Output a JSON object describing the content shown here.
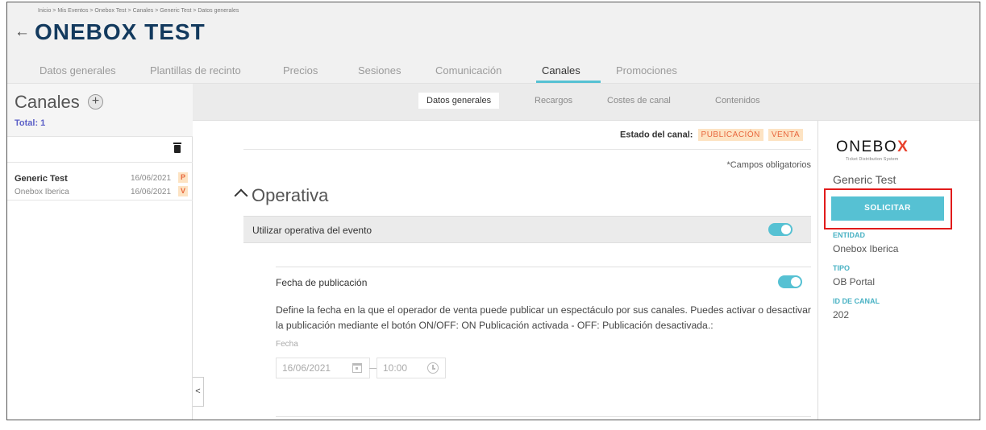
{
  "header": {
    "breadcrumb": "Inicio > Mis Eventos > Onebox Test > Canales > Generic Test > Datos generales",
    "back_icon": "←",
    "title": "ONEBOX TEST",
    "tabs": [
      "Datos generales",
      "Plantillas de recinto",
      "Precios",
      "Sesiones",
      "Comunicación",
      "Canales",
      "Promociones"
    ],
    "active_tab": "Canales"
  },
  "sidebar": {
    "title": "Canales",
    "add_icon": "+",
    "total": "Total: 1",
    "items": [
      {
        "name": "Generic Test",
        "entity": "Onebox Iberica",
        "date1": "16/06/2021",
        "badge1": "P",
        "date2": "16/06/2021",
        "badge2": "V"
      }
    ]
  },
  "subnav": {
    "tabs": [
      "Datos generales",
      "Recargos",
      "Costes de canal",
      "Contenidos"
    ],
    "active": "Datos generales"
  },
  "main": {
    "collapse_icon": "<",
    "estado_label": "Estado del canal:",
    "estado_badges": [
      "PUBLICACIÓN",
      "VENTA"
    ],
    "mandatory": "*Campos obligatorios",
    "section_title": "Operativa",
    "operativa_label": "Utilizar operativa del evento",
    "operativa_toggle_on": true,
    "fecha_label": "Fecha de publicación",
    "fecha_toggle_on": true,
    "description": "Define la fecha en la que el operador de venta puede publicar un espectáculo por sus canales. Puedes activar o desactivar la publicación mediante el botón ON/OFF: ON Publicación activada - OFF: Publicación desactivada.:",
    "field_label": "Fecha",
    "date_value": "16/06/2021",
    "time_value": "10:00"
  },
  "right_panel": {
    "logo": "ONEBO",
    "logo_x": "X",
    "logo_sub": "Ticket Distribution System",
    "name": "Generic Test",
    "button": "SOLICITAR",
    "entidad_label": "ENTIDAD",
    "entidad_value": "Onebox Iberica",
    "tipo_label": "TIPO",
    "tipo_value": "OB Portal",
    "id_label": "ID DE CANAL",
    "id_value": "202"
  },
  "colors": {
    "accent": "#56c1d3",
    "title": "#133a5e",
    "badge_text": "#e8683f",
    "badge_bg": "#fde3c3",
    "highlight": "#e11b1b",
    "total": "#5b5fc7"
  }
}
